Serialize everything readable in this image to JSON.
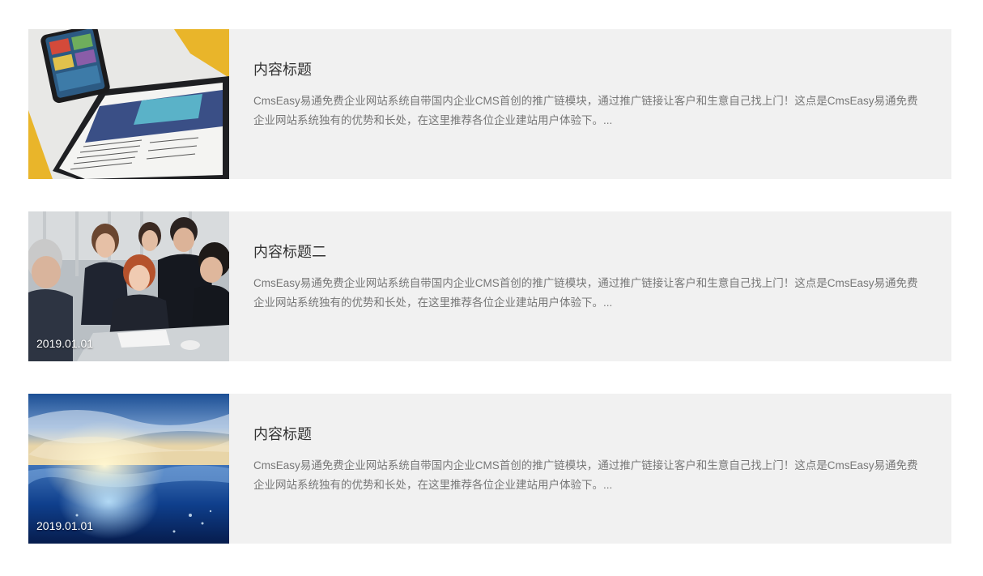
{
  "articles": [
    {
      "title": "内容标题",
      "desc": "CmsEasy易通免费企业网站系统自带国内企业CMS首创的推广链模块，通过推广链接让客户和生意自己找上门！这点是CmsEasy易通免费企业网站系统独有的优势和长处，在这里推荐各位企业建站用户体验下。...",
      "date": "",
      "image": "tablet-reading-photo"
    },
    {
      "title": "内容标题二",
      "desc": "CmsEasy易通免费企业网站系统自带国内企业CMS首创的推广链模块，通过推广链接让客户和生意自己找上门！这点是CmsEasy易通免费企业网站系统独有的优势和长处，在这里推荐各位企业建站用户体验下。...",
      "date": "2019.01.01",
      "image": "business-meeting-photo"
    },
    {
      "title": "内容标题",
      "desc": "CmsEasy易通免费企业网站系统自带国内企业CMS首创的推广链模块，通过推广链接让客户和生意自己找上门！这点是CmsEasy易通免费企业网站系统独有的优势和长处，在这里推荐各位企业建站用户体验下。...",
      "date": "2019.01.01",
      "image": "ocean-sunrise-photo"
    }
  ]
}
